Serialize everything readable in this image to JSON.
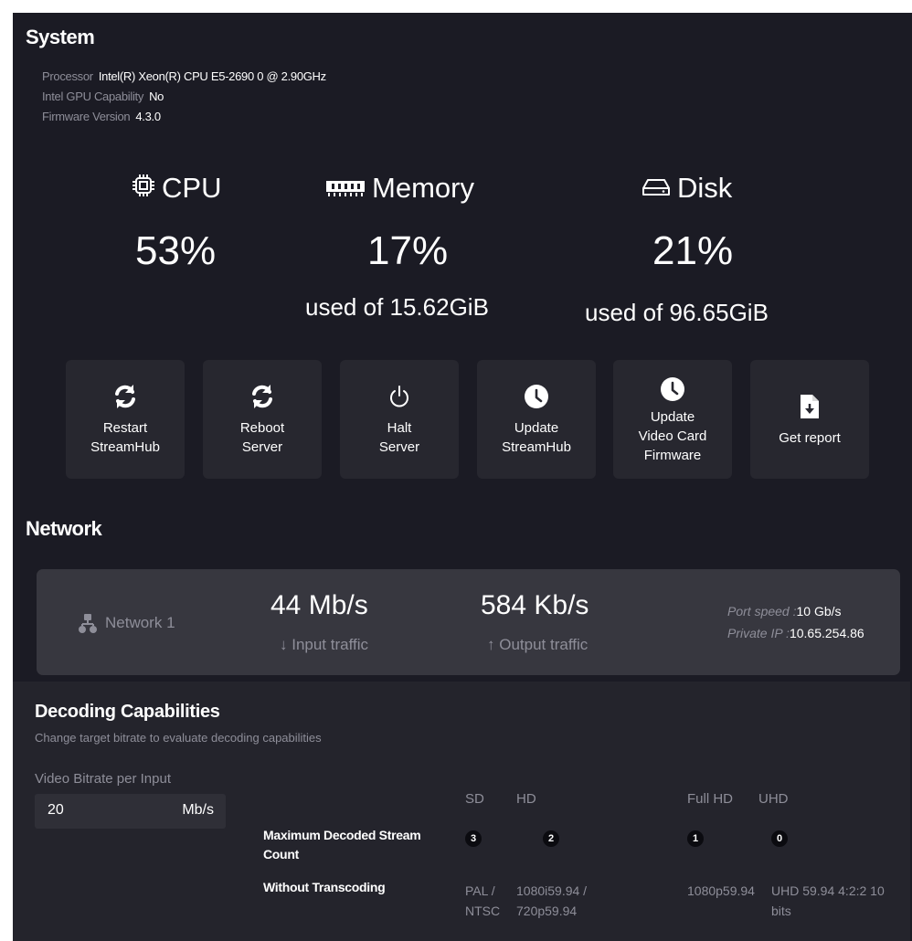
{
  "system": {
    "title": "System",
    "processor_label": "Processor",
    "processor_value": "Intel(R) Xeon(R) CPU E5-2690 0 @ 2.90GHz",
    "gpu_label": "Intel GPU Capability",
    "gpu_value": "No",
    "firmware_label": "Firmware Version",
    "firmware_value": "4.3.0"
  },
  "metrics": {
    "cpu": {
      "label": "CPU",
      "percent": "53%",
      "icon": "cpu-chip-icon"
    },
    "memory": {
      "label": "Memory",
      "percent": "17%",
      "sub": "used of 15.62GiB",
      "icon": "memory-icon"
    },
    "disk": {
      "label": "Disk",
      "percent": "21%",
      "sub": "used of 96.65GiB",
      "icon": "disk-icon"
    }
  },
  "actions": [
    {
      "label1": "Restart",
      "label2": "StreamHub",
      "icon": "refresh-icon"
    },
    {
      "label1": "Reboot",
      "label2": "Server",
      "icon": "refresh-icon"
    },
    {
      "label1": "Halt",
      "label2": "Server",
      "icon": "power-icon"
    },
    {
      "label1": "Update",
      "label2": "StreamHub",
      "icon": "clock-icon"
    },
    {
      "label1": "Update",
      "label2": "Video Card",
      "label3": "Firmware",
      "icon": "clock-icon"
    },
    {
      "label1": "Get report",
      "icon": "file-download-icon"
    }
  ],
  "network": {
    "title": "Network",
    "name": "Network 1",
    "input_rate": "44 Mb/s",
    "input_label": "↓ Input traffic",
    "output_rate": "584 Kb/s",
    "output_label": "↑ Output traffic",
    "port_speed_label": "Port speed :",
    "port_speed_value": "10 Gb/s",
    "private_ip_label": "Private IP :",
    "private_ip_value": "10.65.254.86"
  },
  "decoding": {
    "title": "Decoding Capabilities",
    "subtitle": "Change target bitrate to evaluate decoding capabilities",
    "bitrate_label": "Video Bitrate per Input",
    "bitrate_value": "20",
    "bitrate_unit": "Mb/s",
    "columns": [
      "SD",
      "HD",
      "Full HD",
      "UHD"
    ],
    "row_max_label": "Maximum Decoded Stream Count",
    "counts": [
      "3",
      "2",
      "1",
      "0"
    ],
    "row_without_label": "Without Transcoding",
    "formats": [
      "PAL / NTSC",
      "1080i59.94 / 720p59.94",
      "1080p59.94",
      "UHD 59.94 4:2:2 10 bits"
    ]
  },
  "colors": {
    "background": "#1b1b24",
    "card": "#27272f",
    "network_card": "#37373f",
    "muted_text": "#8e8e99"
  }
}
